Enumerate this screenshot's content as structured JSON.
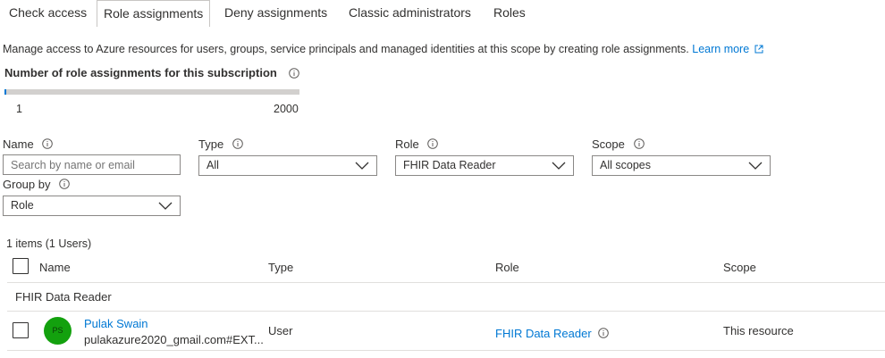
{
  "tabs": [
    {
      "label": "Check access"
    },
    {
      "label": "Role assignments"
    },
    {
      "label": "Deny assignments"
    },
    {
      "label": "Classic administrators"
    },
    {
      "label": "Roles"
    }
  ],
  "active_tab": "Role assignments",
  "description": {
    "text": "Manage access to Azure resources for users, groups, service principals and managed identities at this scope by creating role assignments.",
    "link": "Learn more"
  },
  "assignment_count": {
    "title": "Number of role assignments for this subscription",
    "current": 1,
    "min_label": "1",
    "max_label": "2000",
    "fill_fraction": 0.0005
  },
  "filters": {
    "name": {
      "label": "Name",
      "placeholder": "Search by name or email",
      "value": ""
    },
    "type": {
      "label": "Type",
      "value": "All"
    },
    "role": {
      "label": "Role",
      "value": "FHIR Data Reader"
    },
    "scope": {
      "label": "Scope",
      "value": "All scopes"
    },
    "group_by": {
      "label": "Group by",
      "value": "Role"
    }
  },
  "table": {
    "summary": "1 items (1 Users)",
    "columns": [
      "Name",
      "Type",
      "Role",
      "Scope"
    ],
    "groups": [
      {
        "label": "FHIR Data Reader",
        "rows": [
          {
            "avatar_initials": "PS",
            "name": "Pulak Swain",
            "email": "pulakazure2020_gmail.com#EXT...",
            "type": "User",
            "role": "FHIR Data Reader",
            "scope": "This resource"
          }
        ]
      }
    ]
  },
  "colors": {
    "link": "#0078d4",
    "avatar": "#13a10e",
    "border": "#8a8886",
    "divider": "#e1dfdd"
  },
  "icons": [
    "info-icon",
    "external-link-icon",
    "chevron-down-icon",
    "checkbox"
  ]
}
